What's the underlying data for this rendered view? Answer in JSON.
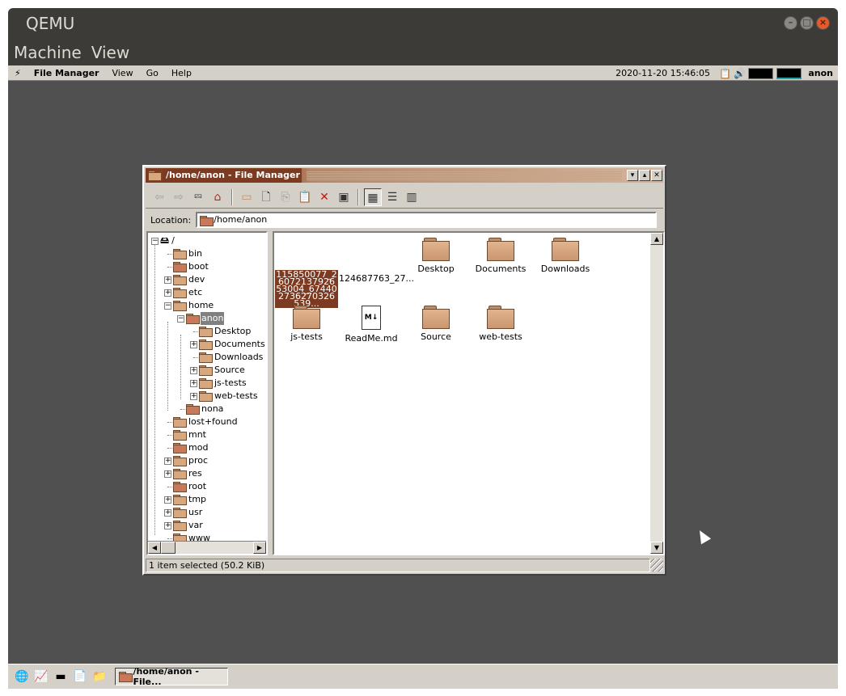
{
  "qemu": {
    "title": "QEMU",
    "menu": [
      "Machine",
      "View"
    ],
    "controls": {
      "minimize": "–",
      "maximize": "□",
      "close": "×"
    }
  },
  "menubar": {
    "launcher_icon": "⚡",
    "app_name": "File Manager",
    "items": [
      "View",
      "Go",
      "Help"
    ],
    "clock": "2020-11-20 15:46:05",
    "user": "anon"
  },
  "window": {
    "title": "/home/anon - File Manager",
    "buttons": {
      "minimize": "▾",
      "maximize": "▴",
      "close": "✕"
    }
  },
  "toolbar": {
    "back": "⇦",
    "forward": "⇨",
    "up": "⮹",
    "home": "⌂",
    "new_folder": "▭",
    "new_file": "🗋",
    "copy": "⎘",
    "paste": "📋",
    "delete": "✕",
    "terminal": "▣",
    "view_icons": "▦",
    "view_list": "☰",
    "view_columns": "▥"
  },
  "location": {
    "label": "Location:",
    "value": "/home/anon"
  },
  "tree": [
    {
      "name": "/",
      "depth": 0,
      "expander": "−",
      "drive": true
    },
    {
      "name": "bin",
      "depth": 1,
      "expander": ""
    },
    {
      "name": "boot",
      "depth": 1,
      "expander": "",
      "red": true
    },
    {
      "name": "dev",
      "depth": 1,
      "expander": "+"
    },
    {
      "name": "etc",
      "depth": 1,
      "expander": "+"
    },
    {
      "name": "home",
      "depth": 1,
      "expander": "−"
    },
    {
      "name": "anon",
      "depth": 2,
      "expander": "−",
      "selected": true,
      "home": true
    },
    {
      "name": "Desktop",
      "depth": 3,
      "expander": ""
    },
    {
      "name": "Documents",
      "depth": 3,
      "expander": "+"
    },
    {
      "name": "Downloads",
      "depth": 3,
      "expander": ""
    },
    {
      "name": "Source",
      "depth": 3,
      "expander": "+"
    },
    {
      "name": "js-tests",
      "depth": 3,
      "expander": "+"
    },
    {
      "name": "web-tests",
      "depth": 3,
      "expander": "+"
    },
    {
      "name": "nona",
      "depth": 2,
      "expander": "",
      "red": true
    },
    {
      "name": "lost+found",
      "depth": 1,
      "expander": ""
    },
    {
      "name": "mnt",
      "depth": 1,
      "expander": ""
    },
    {
      "name": "mod",
      "depth": 1,
      "expander": "",
      "red": true
    },
    {
      "name": "proc",
      "depth": 1,
      "expander": "+"
    },
    {
      "name": "res",
      "depth": 1,
      "expander": "+"
    },
    {
      "name": "root",
      "depth": 1,
      "expander": "",
      "red": true
    },
    {
      "name": "tmp",
      "depth": 1,
      "expander": "+"
    },
    {
      "name": "usr",
      "depth": 1,
      "expander": "+"
    },
    {
      "name": "var",
      "depth": 1,
      "expander": "+"
    },
    {
      "name": "www",
      "depth": 1,
      "expander": ""
    }
  ],
  "files": [
    {
      "name": "115850077_2607213792653004_674402736270326539...",
      "type": "image",
      "selected": true
    },
    {
      "name": "124687763_27...",
      "type": "image"
    },
    {
      "name": "Desktop",
      "type": "folder"
    },
    {
      "name": "Documents",
      "type": "folder"
    },
    {
      "name": "Downloads",
      "type": "folder"
    },
    {
      "name": "js-tests",
      "type": "folder"
    },
    {
      "name": "ReadMe.md",
      "type": "markdown",
      "badge": "M↓"
    },
    {
      "name": "Source",
      "type": "folder"
    },
    {
      "name": "web-tests",
      "type": "folder"
    }
  ],
  "status": {
    "text": "1 item selected (50.2 KiB)"
  },
  "taskbar": {
    "icons": [
      "🌐",
      "📈",
      "▬",
      "📄",
      "📁"
    ],
    "task_label": "/home/anon - File..."
  },
  "colors": {
    "accent": "#7c3a20",
    "chrome": "#d4d0c8",
    "desktop": "#505050"
  }
}
